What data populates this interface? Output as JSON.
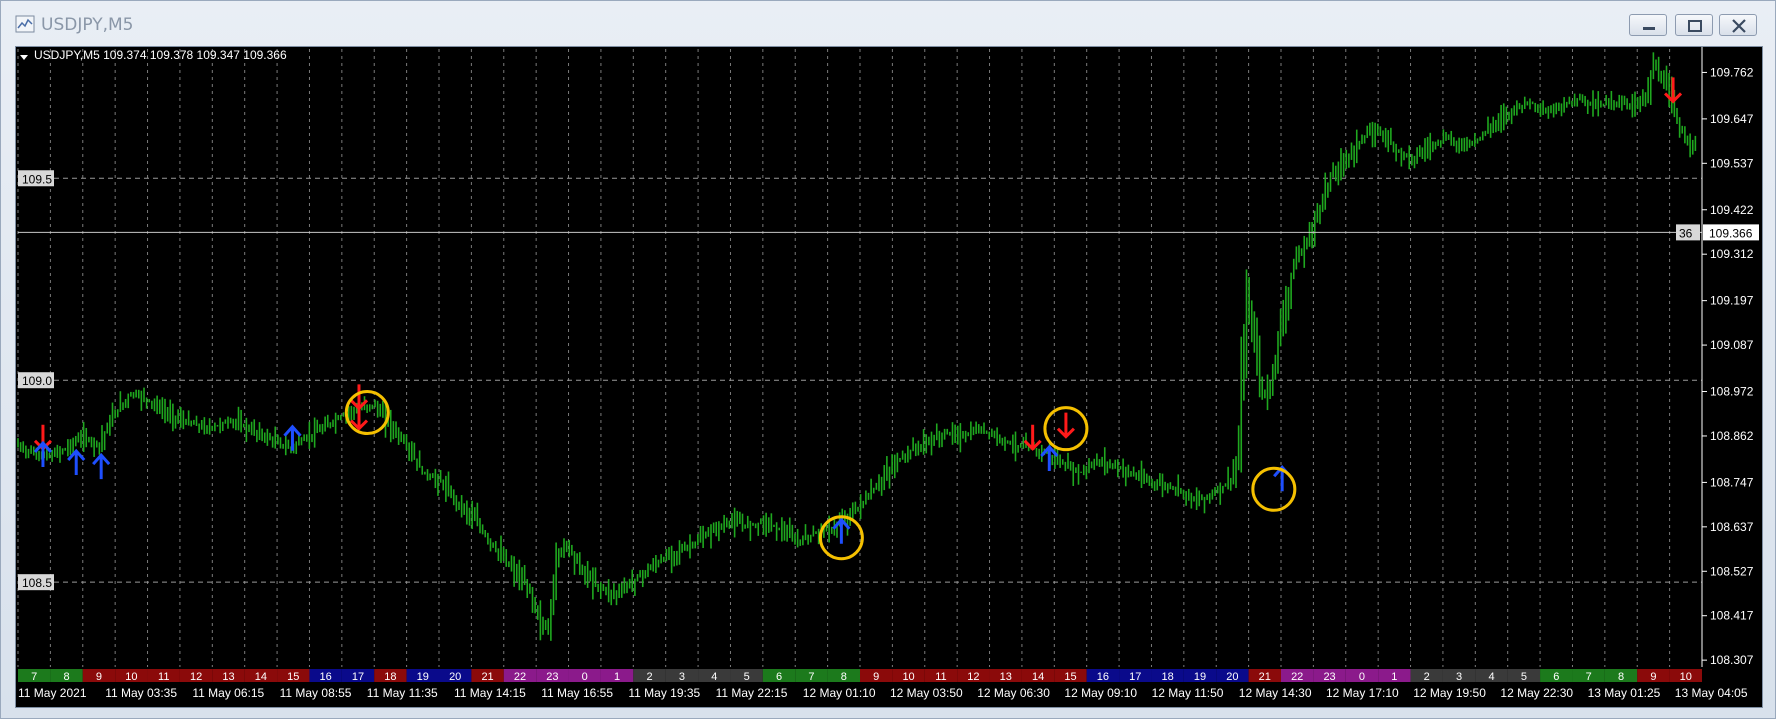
{
  "window": {
    "title": "USDJPY,M5",
    "buttons": {
      "minimize": "minimize-icon",
      "restore": "restore-icon",
      "close": "close-icon"
    }
  },
  "chart_header": {
    "menu_icon": "triangle-down-icon",
    "symbol": "USDJPY,M5",
    "ohlc": "109.374 109.378 109.347 109.366"
  },
  "colors": {
    "background": "#000000",
    "candles": "#1fa81f",
    "grid": "#9a9a9a",
    "buy_arrow": "#1e4fff",
    "buy_arrow_light": "#2fd6ff",
    "sell_arrow": "#ff1a1a",
    "sell_arrow_magenta": "#e040a0",
    "highlight_circle": "#f5c000"
  },
  "chart_data": {
    "type": "candlestick",
    "symbol": "USDJPY",
    "timeframe": "M5",
    "ylim": [
      108.29,
      109.82
    ],
    "y_ticks": [
      "109.762",
      "109.647",
      "109.537",
      "109.422",
      "109.312",
      "109.197",
      "109.087",
      "108.972",
      "108.862",
      "108.747",
      "108.637",
      "108.527",
      "108.417",
      "108.307"
    ],
    "level_labels": [
      "109.5",
      "109.0",
      "108.5"
    ],
    "levels": [
      109.5,
      109.0,
      108.5
    ],
    "current_price": "109.366",
    "current_price_tag": "36",
    "current_value": 109.366,
    "x_labels": [
      "11 May 2021",
      "11 May 03:35",
      "11 May 06:15",
      "11 May 08:55",
      "11 May 11:35",
      "11 May 14:15",
      "11 May 16:55",
      "11 May 19:35",
      "11 May 22:15",
      "12 May 01:10",
      "12 May 03:50",
      "12 May 06:30",
      "12 May 09:10",
      "12 May 11:50",
      "12 May 14:30",
      "12 May 17:10",
      "12 May 19:50",
      "12 May 22:30",
      "13 May 01:25",
      "13 May 04:05"
    ],
    "hour_labels": [
      "7",
      "8",
      "9",
      "10",
      "11",
      "12",
      "13",
      "14",
      "15",
      "16",
      "17",
      "18",
      "19",
      "20",
      "21",
      "22",
      "23",
      "0",
      "1",
      "2",
      "3",
      "4",
      "5",
      "6",
      "7",
      "8",
      "9",
      "10",
      "11",
      "12",
      "13",
      "14",
      "15",
      "16",
      "17",
      "18",
      "19",
      "20",
      "21",
      "22",
      "23",
      "0",
      "1",
      "2",
      "3",
      "4",
      "5",
      "6",
      "7",
      "8",
      "9",
      "10"
    ],
    "hour_colors": [
      "#1c7a1c",
      "#1c7a1c",
      "#8b0a0a",
      "#8b0a0a",
      "#8b0a0a",
      "#8b0a0a",
      "#8b0a0a",
      "#8b0a0a",
      "#8b0a0a",
      "#0a0a8b",
      "#0a0a8b",
      "#8b0a0a",
      "#0a0a8b",
      "#0a0a8b",
      "#8b0a0a",
      "#8b1a8b",
      "#8b1a8b",
      "#8b1a8b",
      "#8b1a8b",
      "#3a3a3a",
      "#3a3a3a",
      "#3a3a3a",
      "#3a3a3a",
      "#1c7a1c",
      "#1c7a1c",
      "#1c7a1c",
      "#8b0a0a",
      "#8b0a0a",
      "#8b0a0a",
      "#8b0a0a",
      "#8b0a0a",
      "#8b0a0a",
      "#8b0a0a",
      "#0a0a8b",
      "#0a0a8b",
      "#0a0a8b",
      "#0a0a8b",
      "#0a0a8b",
      "#8b0a0a",
      "#8b1a8b",
      "#8b1a8b",
      "#8b1a8b",
      "#8b1a8b",
      "#3a3a3a",
      "#3a3a3a",
      "#3a3a3a",
      "#3a3a3a",
      "#1c7a1c",
      "#1c7a1c",
      "#1c7a1c",
      "#8b0a0a",
      "#8b0a0a"
    ],
    "price_path": [
      [
        0,
        108.84
      ],
      [
        2,
        108.82
      ],
      [
        4,
        108.81
      ],
      [
        6,
        108.83
      ],
      [
        8,
        108.86
      ],
      [
        10,
        108.84
      ],
      [
        12,
        108.92
      ],
      [
        14,
        108.97
      ],
      [
        16,
        108.95
      ],
      [
        18,
        108.92
      ],
      [
        20,
        108.9
      ],
      [
        23,
        108.88
      ],
      [
        26,
        108.9
      ],
      [
        29,
        108.87
      ],
      [
        31,
        108.85
      ],
      [
        33,
        108.83
      ],
      [
        35,
        108.86
      ],
      [
        37,
        108.88
      ],
      [
        39,
        108.91
      ],
      [
        41,
        108.93
      ],
      [
        43,
        108.94
      ],
      [
        45,
        108.89
      ],
      [
        47,
        108.84
      ],
      [
        49,
        108.77
      ],
      [
        51,
        108.75
      ],
      [
        53,
        108.7
      ],
      [
        55,
        108.66
      ],
      [
        57,
        108.6
      ],
      [
        59,
        108.55
      ],
      [
        61,
        108.5
      ],
      [
        62,
        108.47
      ],
      [
        63,
        108.4
      ],
      [
        64,
        108.38
      ],
      [
        65,
        108.55
      ],
      [
        66,
        108.6
      ],
      [
        67,
        108.57
      ],
      [
        68,
        108.53
      ],
      [
        70,
        108.49
      ],
      [
        72,
        108.47
      ],
      [
        74,
        108.5
      ],
      [
        76,
        108.53
      ],
      [
        78,
        108.56
      ],
      [
        80,
        108.58
      ],
      [
        82,
        108.6
      ],
      [
        84,
        108.63
      ],
      [
        86,
        108.65
      ],
      [
        88,
        108.64
      ],
      [
        90,
        108.65
      ],
      [
        92,
        108.63
      ],
      [
        94,
        108.6
      ],
      [
        96,
        108.62
      ],
      [
        98,
        108.63
      ],
      [
        100,
        108.66
      ],
      [
        102,
        108.7
      ],
      [
        104,
        108.75
      ],
      [
        106,
        108.8
      ],
      [
        108,
        108.83
      ],
      [
        110,
        108.85
      ],
      [
        112,
        108.87
      ],
      [
        114,
        108.86
      ],
      [
        116,
        108.88
      ],
      [
        118,
        108.86
      ],
      [
        120,
        108.84
      ],
      [
        122,
        108.83
      ],
      [
        124,
        108.82
      ],
      [
        126,
        108.79
      ],
      [
        128,
        108.77
      ],
      [
        130,
        108.8
      ],
      [
        132,
        108.79
      ],
      [
        134,
        108.77
      ],
      [
        136,
        108.75
      ],
      [
        138,
        108.74
      ],
      [
        140,
        108.73
      ],
      [
        142,
        108.7
      ],
      [
        144,
        108.72
      ],
      [
        146,
        108.75
      ],
      [
        147,
        108.8
      ],
      [
        148,
        109.2
      ],
      [
        149,
        109.1
      ],
      [
        150,
        108.95
      ],
      [
        151,
        109.0
      ],
      [
        152,
        109.12
      ],
      [
        153,
        109.22
      ],
      [
        154,
        109.3
      ],
      [
        155,
        109.33
      ],
      [
        156,
        109.38
      ],
      [
        157,
        109.44
      ],
      [
        158,
        109.5
      ],
      [
        160,
        109.55
      ],
      [
        162,
        109.6
      ],
      [
        164,
        109.62
      ],
      [
        166,
        109.57
      ],
      [
        168,
        109.55
      ],
      [
        170,
        109.58
      ],
      [
        172,
        109.6
      ],
      [
        174,
        109.58
      ],
      [
        176,
        109.6
      ],
      [
        178,
        109.64
      ],
      [
        180,
        109.67
      ],
      [
        182,
        109.69
      ],
      [
        184,
        109.66
      ],
      [
        186,
        109.68
      ],
      [
        188,
        109.7
      ],
      [
        190,
        109.68
      ],
      [
        192,
        109.69
      ],
      [
        194,
        109.68
      ],
      [
        196,
        109.7
      ],
      [
        197,
        109.78
      ],
      [
        198,
        109.74
      ],
      [
        199,
        109.7
      ],
      [
        200,
        109.62
      ],
      [
        201,
        109.6
      ],
      [
        202,
        109.58
      ]
    ],
    "signals": [
      {
        "type": "sell",
        "x": 3,
        "y": 108.86
      },
      {
        "type": "buy",
        "x": 3,
        "y": 108.81
      },
      {
        "type": "buy",
        "x": 7,
        "y": 108.79
      },
      {
        "type": "buy",
        "x": 10,
        "y": 108.78
      },
      {
        "type": "buy",
        "x": 33,
        "y": 108.85
      },
      {
        "type": "sell",
        "x": 41,
        "y": 108.91
      },
      {
        "type": "sell",
        "x": 41,
        "y": 108.96
      },
      {
        "type": "buy",
        "x": 99,
        "y": 108.62
      },
      {
        "type": "sell",
        "x": 122,
        "y": 108.86
      },
      {
        "type": "sell",
        "x": 126,
        "y": 108.89
      },
      {
        "type": "buy",
        "x": 124,
        "y": 108.8
      },
      {
        "type": "buy",
        "x": 152,
        "y": 108.75
      },
      {
        "type": "sell",
        "x": 199,
        "y": 109.72
      }
    ],
    "highlight_circles": [
      {
        "x": 42,
        "y": 108.92
      },
      {
        "x": 99,
        "y": 108.61
      },
      {
        "x": 126,
        "y": 108.88
      },
      {
        "x": 151,
        "y": 108.73
      }
    ],
    "grid": true,
    "axis_position": "right"
  }
}
